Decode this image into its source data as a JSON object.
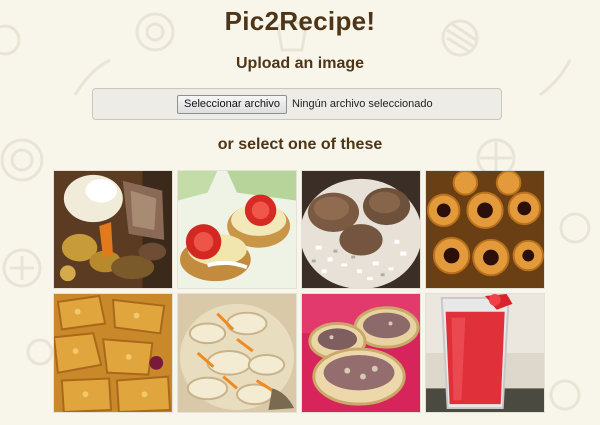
{
  "header": {
    "title": "Pic2Recipe!"
  },
  "upload": {
    "heading": "Upload an image",
    "button_label": "Seleccionar archivo",
    "status_text": "Ningún archivo seleccionado"
  },
  "gallery": {
    "heading": "or select one of these",
    "items": [
      {
        "icon": "stew-photo"
      },
      {
        "icon": "crackers-tomato-photo"
      },
      {
        "icon": "meatballs-rice-photo"
      },
      {
        "icon": "jam-cookies-photo"
      },
      {
        "icon": "fried-food-photo"
      },
      {
        "icon": "cheesy-pasta-photo"
      },
      {
        "icon": "tartlets-photo"
      },
      {
        "icon": "red-drink-photo"
      }
    ]
  },
  "colors": {
    "background": "#f8f6ea",
    "heading": "#4f3517"
  }
}
